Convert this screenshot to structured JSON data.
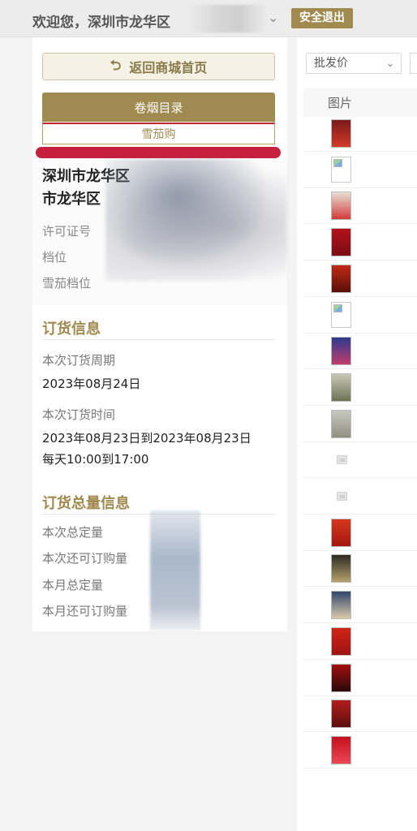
{
  "header": {
    "welcome_text": "欢迎您，深圳市龙华区",
    "logout_label": "安全退出"
  },
  "sidebar": {
    "home_button_label": "返回商城首页",
    "cigarette_catalog_label": "卷烟目录",
    "cigar_purchase_label": "雪茄购"
  },
  "store": {
    "name_line1": "深圳市龙华区",
    "name_line2": "市龙华区",
    "license_label": "许可证号",
    "grade_label": "档位",
    "cigar_grade_label": "雪茄档位"
  },
  "order_info": {
    "title": "订货信息",
    "cycle_label": "本次订货周期",
    "cycle_value": "2023年08月24日",
    "time_label": "本次订货时间",
    "time_value_line1": "2023年08月23日到2023年08月23日",
    "time_value_line2": "每天10:00到17:00"
  },
  "quantity_info": {
    "title": "订货总量信息",
    "total_this": "本次总定量",
    "remaining_this": "本次还可订购量",
    "total_month": "本月总定量",
    "remaining_month": "本月还可订购量"
  },
  "products": {
    "sort_select": "批发价",
    "column_picture": "图片",
    "thumbnails": [
      {
        "kind": "photo",
        "colors": [
          "#7a1a1a",
          "#d43a2a"
        ]
      },
      {
        "kind": "broken"
      },
      {
        "kind": "photo",
        "colors": [
          "#e8e0d4",
          "#d33a3a"
        ]
      },
      {
        "kind": "photo",
        "colors": [
          "#b5121b",
          "#7c0c12"
        ]
      },
      {
        "kind": "photo",
        "colors": [
          "#c02a16",
          "#5a1008"
        ]
      },
      {
        "kind": "broken"
      },
      {
        "kind": "photo",
        "colors": [
          "#2c3a8f",
          "#c23d6d"
        ]
      },
      {
        "kind": "photo",
        "colors": [
          "#c9c7b5",
          "#6c7452"
        ]
      },
      {
        "kind": "photo",
        "colors": [
          "#c8c8bf",
          "#8f9080"
        ]
      },
      {
        "kind": "placeholder"
      },
      {
        "kind": "placeholder"
      },
      {
        "kind": "photo",
        "colors": [
          "#d8361d",
          "#a41810"
        ]
      },
      {
        "kind": "photo",
        "colors": [
          "#2b2b24",
          "#b6a16a"
        ]
      },
      {
        "kind": "photo",
        "colors": [
          "#31466b",
          "#d9c9a8"
        ]
      },
      {
        "kind": "photo",
        "colors": [
          "#d12415",
          "#a11212"
        ]
      },
      {
        "kind": "photo",
        "colors": [
          "#a30f10",
          "#2a0a0a"
        ]
      },
      {
        "kind": "photo",
        "colors": [
          "#b31d1d",
          "#5c1010"
        ]
      },
      {
        "kind": "photo",
        "colors": [
          "#c7101d",
          "#e84855"
        ]
      }
    ]
  }
}
